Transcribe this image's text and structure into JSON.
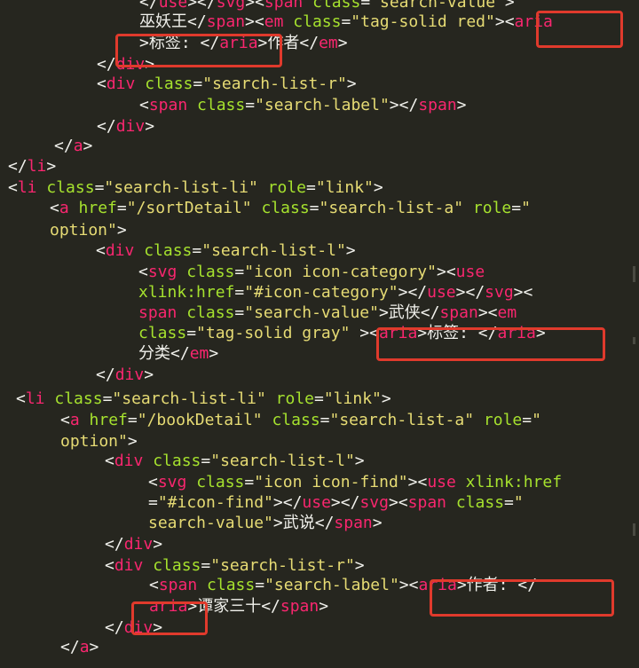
{
  "code_lines": [
    [
      [
        "t",
        "</"
      ],
      [
        "k",
        "use"
      ],
      [
        "t",
        "></"
      ],
      [
        "k",
        "svg"
      ],
      [
        "t",
        "><"
      ],
      [
        "k",
        "span"
      ],
      [
        "t",
        " "
      ],
      [
        "a",
        "class"
      ],
      [
        "t",
        "="
      ],
      [
        "s",
        "\"search-value\""
      ],
      [
        "t",
        ">"
      ]
    ],
    [
      [
        "t",
        "巫妖王</"
      ],
      [
        "k",
        "span"
      ],
      [
        "t",
        "><"
      ],
      [
        "k",
        "em"
      ],
      [
        "t",
        " "
      ],
      [
        "a",
        "class"
      ],
      [
        "t",
        "="
      ],
      [
        "s",
        "\"tag-solid red\""
      ],
      [
        "t",
        "><"
      ],
      [
        "k",
        "aria"
      ]
    ],
    [
      [
        "t",
        ">标签: </"
      ],
      [
        "k",
        "aria"
      ],
      [
        "t",
        ">作者</"
      ],
      [
        "k",
        "em"
      ],
      [
        "t",
        ">"
      ]
    ],
    [
      [
        "t",
        "</"
      ],
      [
        "k",
        "div"
      ],
      [
        "t",
        ">"
      ]
    ],
    [
      [
        "t",
        "<"
      ],
      [
        "k",
        "div"
      ],
      [
        "t",
        " "
      ],
      [
        "a",
        "class"
      ],
      [
        "t",
        "="
      ],
      [
        "s",
        "\"search-list-r\""
      ],
      [
        "t",
        ">"
      ]
    ],
    [
      [
        "t",
        "<"
      ],
      [
        "k",
        "span"
      ],
      [
        "t",
        " "
      ],
      [
        "a",
        "class"
      ],
      [
        "t",
        "="
      ],
      [
        "s",
        "\"search-label\""
      ],
      [
        "t",
        "></"
      ],
      [
        "k",
        "span"
      ],
      [
        "t",
        ">"
      ]
    ],
    [
      [
        "t",
        "</"
      ],
      [
        "k",
        "div"
      ],
      [
        "t",
        ">"
      ]
    ],
    [
      [
        "t",
        "</"
      ],
      [
        "k",
        "a"
      ],
      [
        "t",
        ">"
      ]
    ],
    [
      [
        "t",
        "</"
      ],
      [
        "k",
        "li"
      ],
      [
        "t",
        ">"
      ]
    ],
    [
      [
        "t",
        "<"
      ],
      [
        "k",
        "li"
      ],
      [
        "t",
        " "
      ],
      [
        "a",
        "class"
      ],
      [
        "t",
        "="
      ],
      [
        "s",
        "\"search-list-li\""
      ],
      [
        "t",
        " "
      ],
      [
        "a",
        "role"
      ],
      [
        "t",
        "="
      ],
      [
        "s",
        "\"link\""
      ],
      [
        "t",
        ">"
      ]
    ],
    [
      [
        "t",
        "<"
      ],
      [
        "k",
        "a"
      ],
      [
        "t",
        " "
      ],
      [
        "a",
        "href"
      ],
      [
        "t",
        "="
      ],
      [
        "s",
        "\"/sortDetail\""
      ],
      [
        "t",
        " "
      ],
      [
        "a",
        "class"
      ],
      [
        "t",
        "="
      ],
      [
        "s",
        "\"search-list-a\""
      ],
      [
        "t",
        " "
      ],
      [
        "a",
        "role"
      ],
      [
        "t",
        "="
      ],
      [
        "s",
        "\""
      ]
    ],
    [
      [
        "s",
        "option\""
      ],
      [
        "t",
        ">"
      ]
    ],
    [
      [
        "t",
        "<"
      ],
      [
        "k",
        "div"
      ],
      [
        "t",
        " "
      ],
      [
        "a",
        "class"
      ],
      [
        "t",
        "="
      ],
      [
        "s",
        "\"search-list-l\""
      ],
      [
        "t",
        ">"
      ]
    ],
    [
      [
        "t",
        "<"
      ],
      [
        "k",
        "svg"
      ],
      [
        "t",
        " "
      ],
      [
        "a",
        "class"
      ],
      [
        "t",
        "="
      ],
      [
        "s",
        "\"icon icon-category\""
      ],
      [
        "t",
        "><"
      ],
      [
        "k",
        "use"
      ]
    ],
    [
      [
        "a",
        "xlink:href"
      ],
      [
        "t",
        "="
      ],
      [
        "s",
        "\"#icon-category\""
      ],
      [
        "t",
        "></"
      ],
      [
        "k",
        "use"
      ],
      [
        "t",
        "></"
      ],
      [
        "k",
        "svg"
      ],
      [
        "t",
        "><"
      ]
    ],
    [
      [
        "k",
        "span"
      ],
      [
        "t",
        " "
      ],
      [
        "a",
        "class"
      ],
      [
        "t",
        "="
      ],
      [
        "s",
        "\"search-value\""
      ],
      [
        "t",
        ">武侠</"
      ],
      [
        "k",
        "span"
      ],
      [
        "t",
        "><"
      ],
      [
        "k",
        "em"
      ]
    ],
    [
      [
        "a",
        "class"
      ],
      [
        "t",
        "="
      ],
      [
        "s",
        "\"tag-solid gray\""
      ],
      [
        "t",
        " ><"
      ],
      [
        "k",
        "aria"
      ],
      [
        "t",
        ">标签: </"
      ],
      [
        "k",
        "aria"
      ],
      [
        "t",
        ">"
      ]
    ],
    [
      [
        "t",
        "分类</"
      ],
      [
        "k",
        "em"
      ],
      [
        "t",
        ">"
      ]
    ],
    [
      [
        "t",
        "</"
      ],
      [
        "k",
        "div"
      ],
      [
        "t",
        ">"
      ]
    ],
    [
      [
        "t",
        "<"
      ],
      [
        "k",
        "li"
      ],
      [
        "t",
        " "
      ],
      [
        "a",
        "class"
      ],
      [
        "t",
        "="
      ],
      [
        "s",
        "\"search-list-li\""
      ],
      [
        "t",
        " "
      ],
      [
        "a",
        "role"
      ],
      [
        "t",
        "="
      ],
      [
        "s",
        "\"link\""
      ],
      [
        "t",
        ">"
      ]
    ],
    [
      [
        "t",
        "<"
      ],
      [
        "k",
        "a"
      ],
      [
        "t",
        " "
      ],
      [
        "a",
        "href"
      ],
      [
        "t",
        "="
      ],
      [
        "s",
        "\"/bookDetail\""
      ],
      [
        "t",
        " "
      ],
      [
        "a",
        "class"
      ],
      [
        "t",
        "="
      ],
      [
        "s",
        "\"search-list-a\""
      ],
      [
        "t",
        " "
      ],
      [
        "a",
        "role"
      ],
      [
        "t",
        "="
      ],
      [
        "s",
        "\""
      ]
    ],
    [
      [
        "s",
        "option\""
      ],
      [
        "t",
        ">"
      ]
    ],
    [
      [
        "t",
        "<"
      ],
      [
        "k",
        "div"
      ],
      [
        "t",
        " "
      ],
      [
        "a",
        "class"
      ],
      [
        "t",
        "="
      ],
      [
        "s",
        "\"search-list-l\""
      ],
      [
        "t",
        ">"
      ]
    ],
    [
      [
        "t",
        "<"
      ],
      [
        "k",
        "svg"
      ],
      [
        "t",
        " "
      ],
      [
        "a",
        "class"
      ],
      [
        "t",
        "="
      ],
      [
        "s",
        "\"icon icon-find\""
      ],
      [
        "t",
        "><"
      ],
      [
        "k",
        "use"
      ],
      [
        "t",
        " "
      ],
      [
        "a",
        "xlink:href"
      ]
    ],
    [
      [
        "t",
        "="
      ],
      [
        "s",
        "\"#icon-find\""
      ],
      [
        "t",
        "></"
      ],
      [
        "k",
        "use"
      ],
      [
        "t",
        "></"
      ],
      [
        "k",
        "svg"
      ],
      [
        "t",
        "><"
      ],
      [
        "k",
        "span"
      ],
      [
        "t",
        " "
      ],
      [
        "a",
        "class"
      ],
      [
        "t",
        "="
      ],
      [
        "s",
        "\""
      ]
    ],
    [
      [
        "s",
        "search-value\""
      ],
      [
        "t",
        ">武说</"
      ],
      [
        "k",
        "span"
      ],
      [
        "t",
        ">"
      ]
    ],
    [
      [
        "t",
        "</"
      ],
      [
        "k",
        "div"
      ],
      [
        "t",
        ">"
      ]
    ],
    [
      [
        "t",
        "<"
      ],
      [
        "k",
        "div"
      ],
      [
        "t",
        " "
      ],
      [
        "a",
        "class"
      ],
      [
        "t",
        "="
      ],
      [
        "s",
        "\"search-list-r\""
      ],
      [
        "t",
        ">"
      ]
    ],
    [
      [
        "t",
        "<"
      ],
      [
        "k",
        "span"
      ],
      [
        "t",
        " "
      ],
      [
        "a",
        "class"
      ],
      [
        "t",
        "="
      ],
      [
        "s",
        "\"search-label\""
      ],
      [
        "t",
        "><"
      ],
      [
        "k",
        "aria"
      ],
      [
        "t",
        ">作者: </"
      ]
    ],
    [
      [
        "k",
        "aria"
      ],
      [
        "t",
        ">谭家三十</"
      ],
      [
        "k",
        "span"
      ],
      [
        "t",
        ">"
      ]
    ],
    [
      [
        "t",
        "</"
      ],
      [
        "k",
        "div"
      ],
      [
        "t",
        ">"
      ]
    ],
    [
      [
        "t",
        "</"
      ],
      [
        "k",
        "a"
      ],
      [
        "t",
        ">"
      ]
    ]
  ],
  "colors": {
    "background": "#26261f",
    "tag": "#f9266f",
    "attribute": "#a6e22e",
    "string": "#e6db74",
    "text": "#f1f1ec",
    "highlight_box": "#e03a2c"
  }
}
